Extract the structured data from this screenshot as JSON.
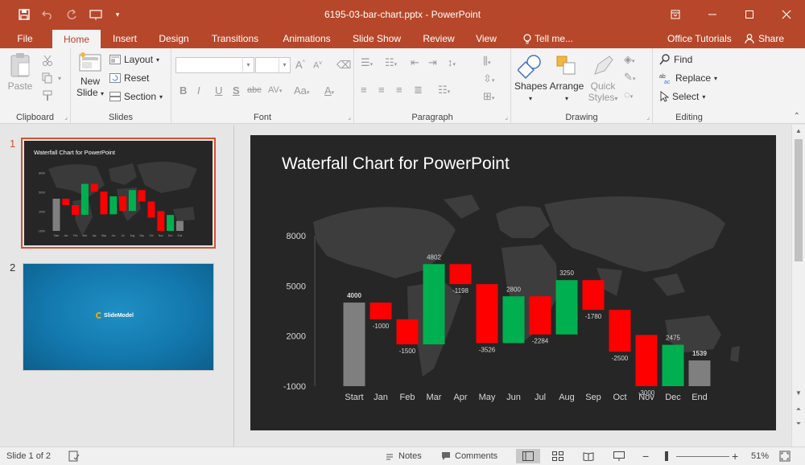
{
  "titlebar": {
    "doc_title": "6195-03-bar-chart.pptx - PowerPoint",
    "save_icon": "save-icon",
    "undo_icon": "undo-icon",
    "redo_icon": "redo-icon",
    "present_icon": "present-from-beginning-icon",
    "customize_icon": "customize-qat-icon"
  },
  "tabs": [
    "File",
    "Home",
    "Insert",
    "Design",
    "Transitions",
    "Animations",
    "Slide Show",
    "Review",
    "View",
    "Tell me..."
  ],
  "active_tab": "Home",
  "tab_right": {
    "office_tutorials": "Office Tutorials",
    "share": "Share"
  },
  "ribbon": {
    "clipboard": {
      "label": "Clipboard",
      "paste": "Paste"
    },
    "slides": {
      "label": "Slides",
      "new_slide_1": "New",
      "new_slide_2": "Slide",
      "layout": "Layout",
      "reset": "Reset",
      "section": "Section"
    },
    "font": {
      "label": "Font",
      "bold": "B",
      "italic": "I",
      "underline": "U",
      "shadow": "S",
      "strike": "abc",
      "spacing": "AV",
      "case": "Aa",
      "color": "A",
      "grow": "A",
      "shrink": "A"
    },
    "paragraph": {
      "label": "Paragraph"
    },
    "drawing": {
      "label": "Drawing",
      "shapes": "Shapes",
      "arrange": "Arrange",
      "quick_1": "Quick",
      "quick_2": "Styles"
    },
    "editing": {
      "label": "Editing",
      "find": "Find",
      "replace": "Replace",
      "select": "Select"
    }
  },
  "thumbnails": [
    {
      "number": "1",
      "title": "Waterfall Chart for PowerPoint"
    },
    {
      "number": "2",
      "brand": "SlideModel"
    }
  ],
  "slide": {
    "title": "Waterfall Chart for PowerPoint"
  },
  "chart_data": {
    "type": "bar",
    "subtype": "waterfall",
    "categories": [
      "Start",
      "Jan",
      "Feb",
      "Mar",
      "Apr",
      "May",
      "Jun",
      "Jul",
      "Aug",
      "Sep",
      "Oct",
      "Nov",
      "Dec",
      "End"
    ],
    "data_labels": [
      "4000",
      "-1000",
      "-1500",
      "4802",
      "-1198",
      "-3526",
      "2800",
      "-2284",
      "3250",
      "-1780",
      "-2500",
      "-3000",
      "2475",
      "1539"
    ],
    "bars": [
      {
        "low": -1000,
        "high": 4000,
        "kind": "total"
      },
      {
        "low": 3000,
        "high": 4000,
        "kind": "decrease"
      },
      {
        "low": 1500,
        "high": 3000,
        "kind": "decrease"
      },
      {
        "low": 1500,
        "high": 6302,
        "kind": "increase"
      },
      {
        "low": 5104,
        "high": 6302,
        "kind": "decrease"
      },
      {
        "low": 1578,
        "high": 5104,
        "kind": "decrease"
      },
      {
        "low": 1578,
        "high": 4378,
        "kind": "increase"
      },
      {
        "low": 2094,
        "high": 4378,
        "kind": "decrease"
      },
      {
        "low": 2094,
        "high": 5344,
        "kind": "increase"
      },
      {
        "low": 3564,
        "high": 5344,
        "kind": "decrease"
      },
      {
        "low": 1064,
        "high": 3564,
        "kind": "decrease"
      },
      {
        "low": -1000,
        "high": 2064,
        "kind": "decrease"
      },
      {
        "low": -1000,
        "high": 1475,
        "kind": "increase"
      },
      {
        "low": -1000,
        "high": 539,
        "kind": "total"
      }
    ],
    "y_ticks": [
      -1000,
      2000,
      5000,
      8000
    ],
    "ylim": [
      -1000,
      8000
    ],
    "colors": {
      "increase": "#00b050",
      "decrease": "#ff0000",
      "total": "#7f7f7f",
      "background": "#262626",
      "text": "#ffffff",
      "label": "#d9d9d9"
    }
  },
  "statusbar": {
    "slide_of": "Slide 1 of 2",
    "notes": "Notes",
    "comments": "Comments",
    "zoom": "51%",
    "zoom_minus": "−",
    "zoom_plus": "+"
  }
}
